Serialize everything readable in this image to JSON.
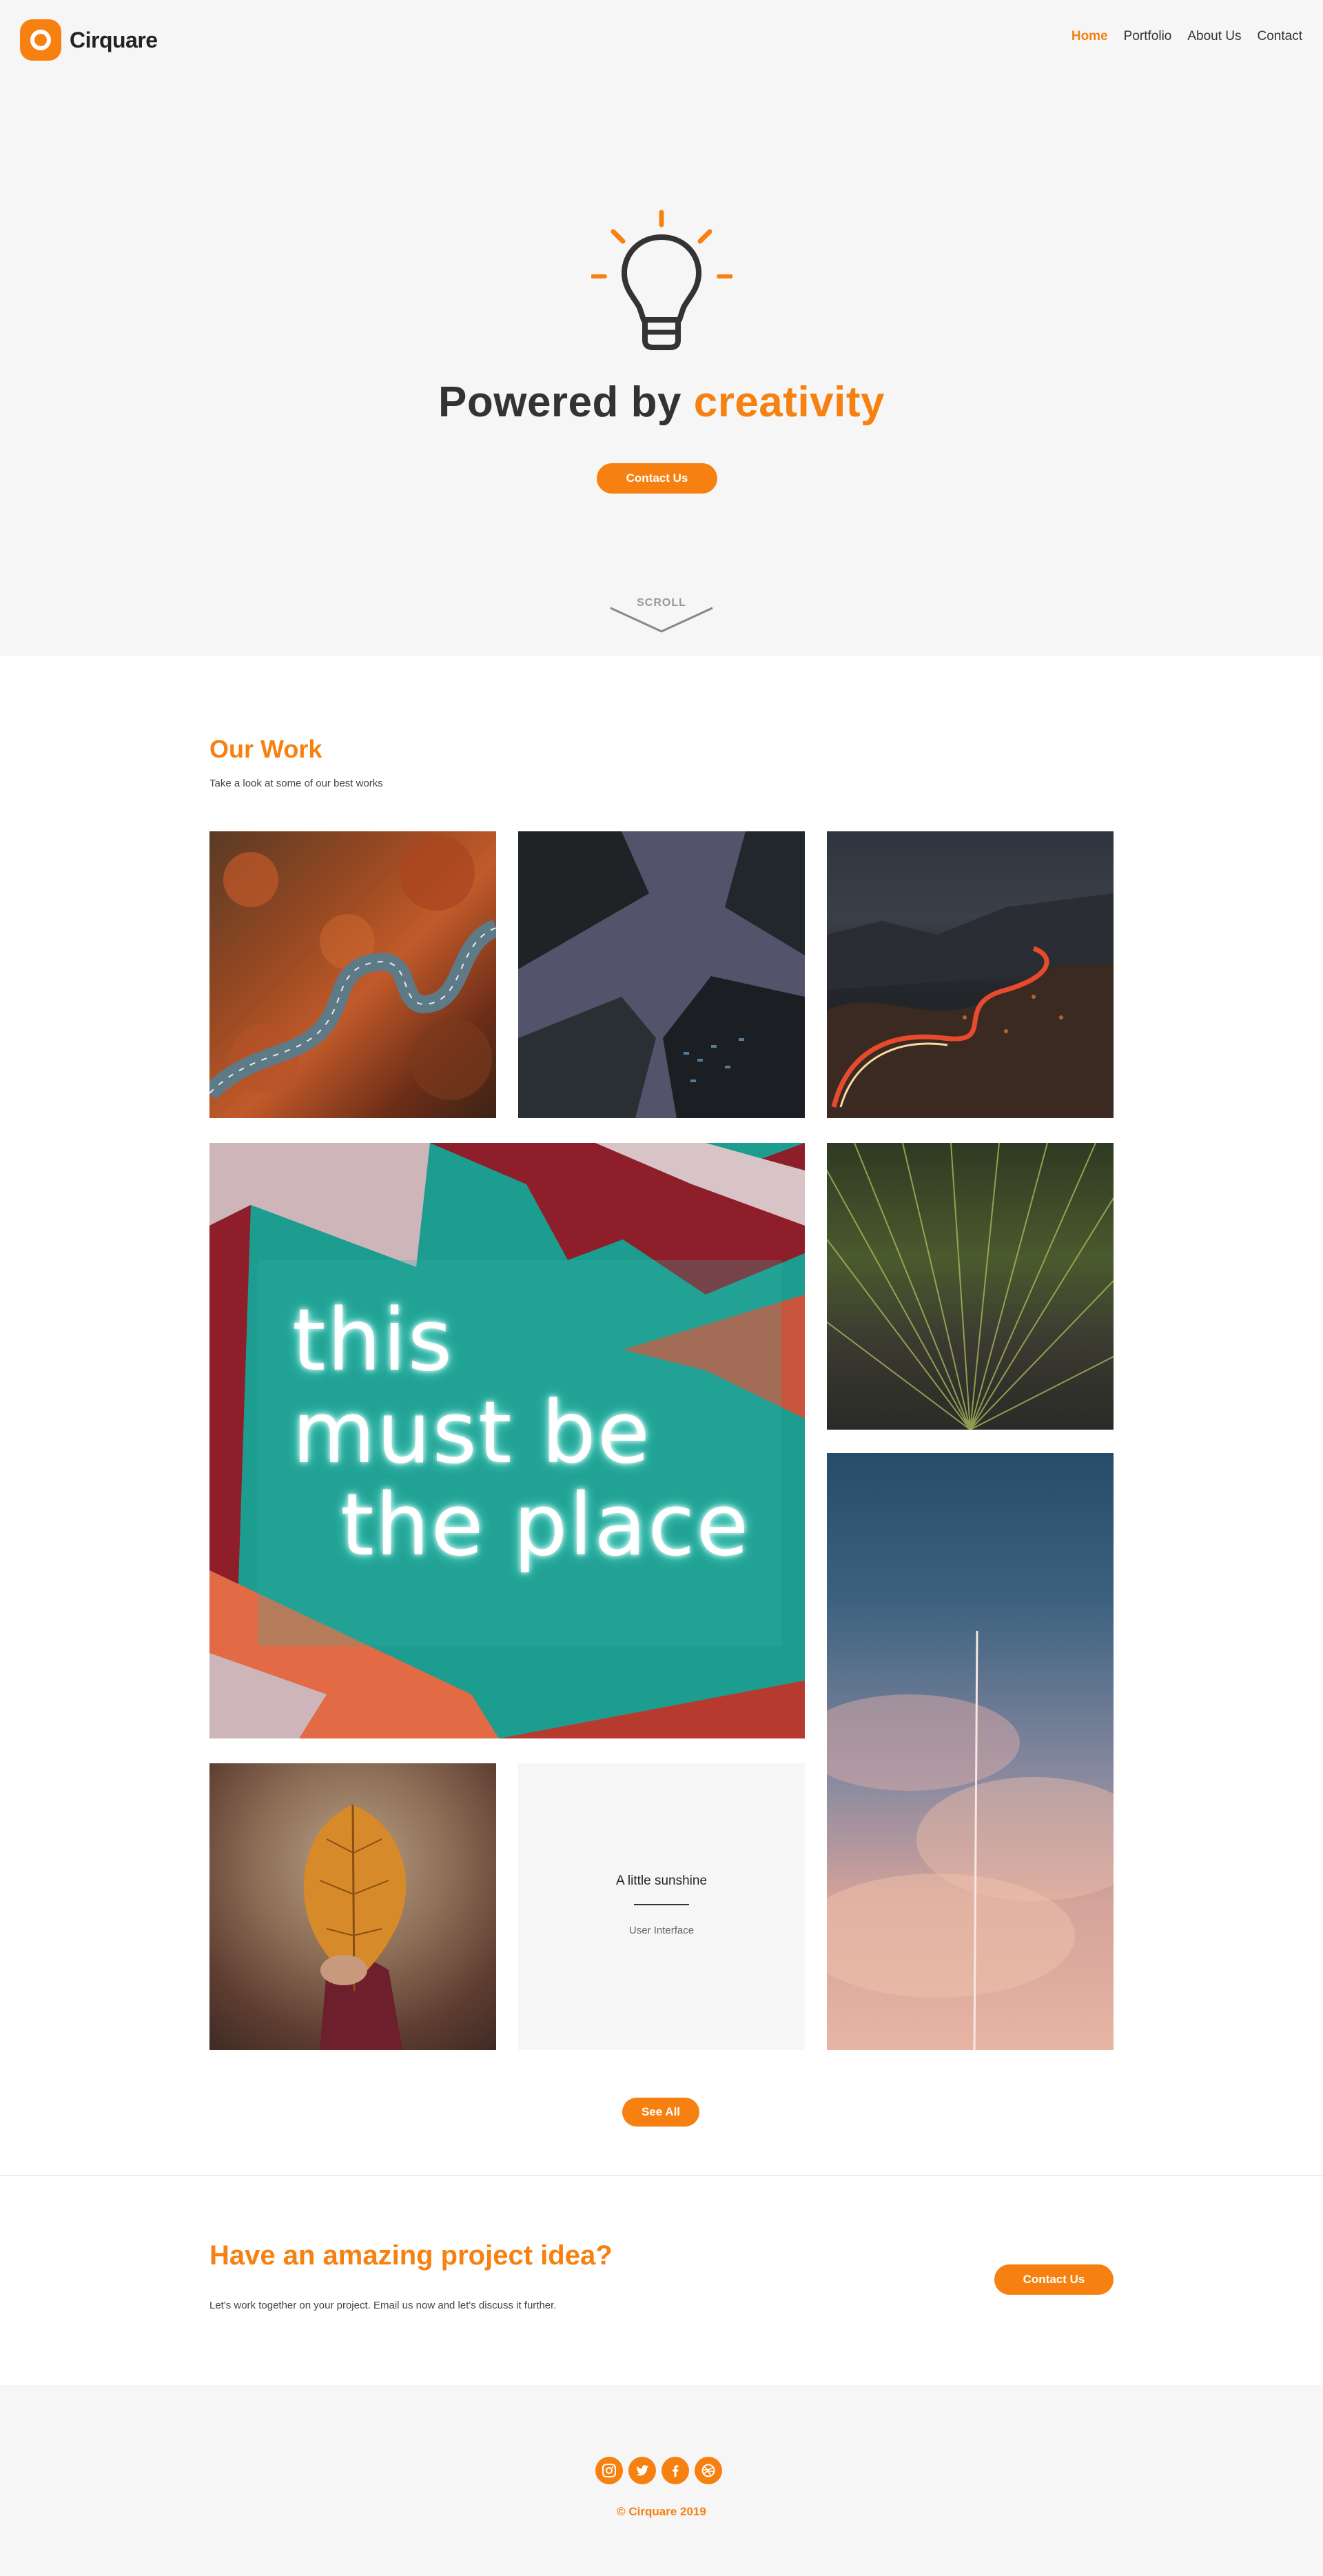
{
  "brand": {
    "name": "Cirquare",
    "accent": "#f68111"
  },
  "nav": [
    {
      "label": "Home",
      "active": true
    },
    {
      "label": "Portfolio"
    },
    {
      "label": "About Us"
    },
    {
      "label": "Contact"
    }
  ],
  "hero": {
    "title_prefix": "Powered by ",
    "title_accent": "creativity",
    "button": "Contact Us",
    "scroll_label": "SCROLL",
    "icon": "lightbulb-icon"
  },
  "work": {
    "title": "Our Work",
    "subtitle": "Take a look at some of our best works",
    "card": {
      "title": "A little sunshine",
      "category": "User Interface"
    },
    "button": "See All"
  },
  "neon": {
    "line1": "this",
    "line2": "must be",
    "line3": "the place"
  },
  "cta": {
    "title": "Have an amazing project idea?",
    "text": "Let's work together on your project. Email us now and let's discuss it further.",
    "button": "Contact Us"
  },
  "footer": {
    "socials": [
      "instagram-icon",
      "twitter-icon",
      "facebook-icon",
      "dribbble-icon"
    ],
    "copyright": "© Cirquare 2019"
  }
}
